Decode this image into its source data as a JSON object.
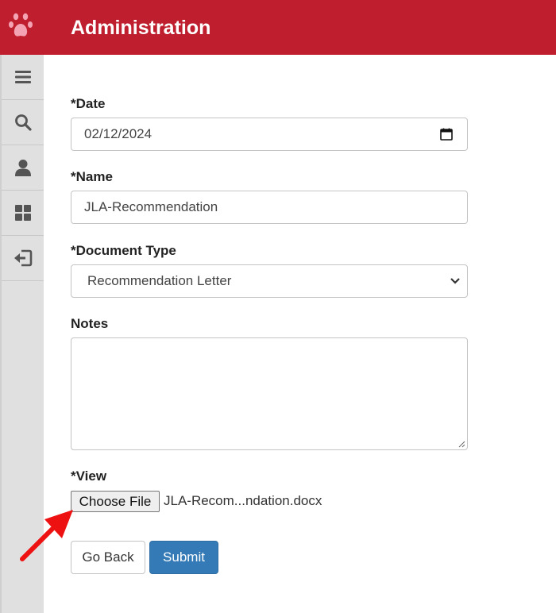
{
  "header": {
    "title": "Administration",
    "logo_icon": "paw-icon",
    "bg_color": "#be1e2d"
  },
  "sidebar": {
    "items": [
      {
        "icon": "menu-icon"
      },
      {
        "icon": "search-icon"
      },
      {
        "icon": "user-icon"
      },
      {
        "icon": "dashboard-grid-icon"
      },
      {
        "icon": "logout-icon"
      }
    ]
  },
  "form": {
    "date": {
      "label": "*Date",
      "value": "02/12/2024"
    },
    "name": {
      "label": "*Name",
      "value": "JLA-Recommendation"
    },
    "document_type": {
      "label": "*Document Type",
      "selected": "Recommendation Letter"
    },
    "notes": {
      "label": "Notes",
      "value": ""
    },
    "view": {
      "label": "*View",
      "button_label": "Choose File",
      "file_name": "JLA-Recom...ndation.docx"
    }
  },
  "buttons": {
    "back_label": "Go Back",
    "submit_label": "Submit",
    "submit_color": "#337ab7"
  },
  "annotation": {
    "arrow_color": "#ee1111"
  }
}
